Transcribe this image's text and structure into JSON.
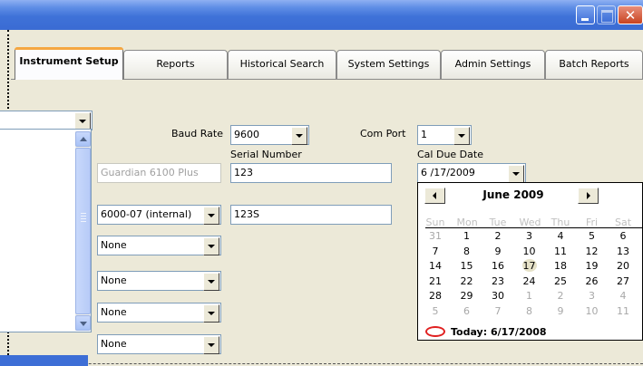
{
  "window": {
    "minimize_icon": "minimize-icon",
    "maximize_icon": "maximize-icon",
    "close_glyph": "✕"
  },
  "tabs": [
    {
      "label": "Instrument Setup",
      "active": true
    },
    {
      "label": "Reports"
    },
    {
      "label": "Historical Search"
    },
    {
      "label": "System Settings"
    },
    {
      "label": "Admin Settings"
    },
    {
      "label": "Batch Reports"
    }
  ],
  "form": {
    "baud_rate_label": "Baud Rate",
    "baud_rate_value": "9600",
    "com_port_label": "Com Port",
    "com_port_value": "1",
    "serial_number_label": "Serial Number",
    "cal_due_date_label": "Cal Due Date",
    "cal_due_date_value": "6 /17/2009",
    "model_name": "Guardian 6100 Plus",
    "serial_number_1": "123",
    "sensor_type": "6000-07 (internal)",
    "serial_number_2": "123S",
    "option_1": "None",
    "option_2": "None",
    "option_3": "None",
    "option_4": "None"
  },
  "calendar": {
    "month_title": "June 2009",
    "weekdays": [
      "Sun",
      "Mon",
      "Tue",
      "Wed",
      "Thu",
      "Fri",
      "Sat"
    ],
    "weeks": [
      [
        "31",
        "1",
        "2",
        "3",
        "4",
        "5",
        "6"
      ],
      [
        "7",
        "8",
        "9",
        "10",
        "11",
        "12",
        "13"
      ],
      [
        "14",
        "15",
        "16",
        "17",
        "18",
        "19",
        "20"
      ],
      [
        "21",
        "22",
        "23",
        "24",
        "25",
        "26",
        "27"
      ],
      [
        "28",
        "29",
        "30",
        "1",
        "2",
        "3",
        "4"
      ],
      [
        "5",
        "6",
        "7",
        "8",
        "9",
        "10",
        "11"
      ]
    ],
    "selected_day": "17",
    "today_label": "Today: 6/17/2008"
  },
  "colors": {
    "titlebar": "#3a6bd3",
    "active_tab_accent": "#f5a742",
    "today_circle": "#e02020"
  }
}
